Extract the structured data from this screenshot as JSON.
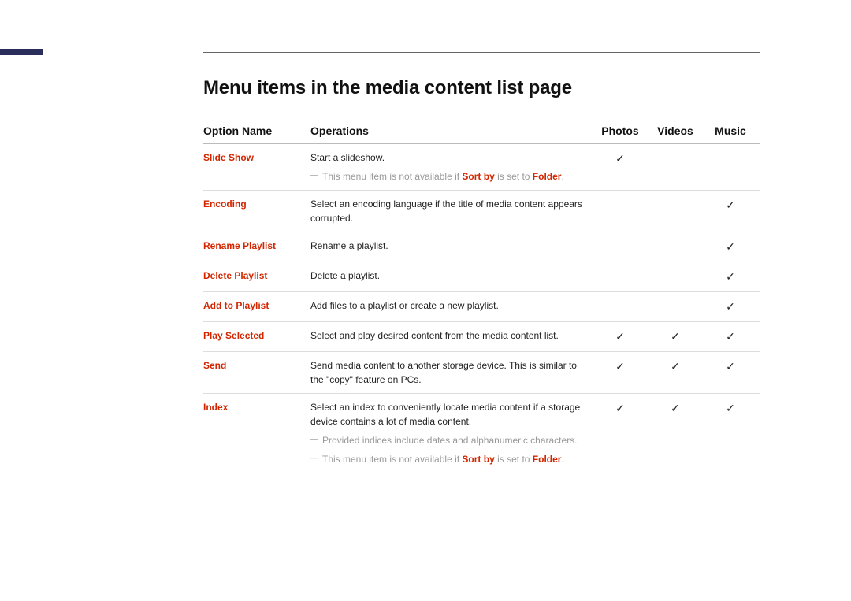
{
  "page": {
    "title": "Menu items in the media content list page"
  },
  "table": {
    "headers": {
      "option": "Option Name",
      "ops": "Operations",
      "photos": "Photos",
      "videos": "Videos",
      "music": "Music"
    },
    "note_sortby_prefix": "This menu item is not available if ",
    "note_sortby_mid": "Sort by",
    "note_sortby_mid2": " is set to ",
    "note_sortby_end": "Folder",
    "rows": {
      "slide_show": {
        "name": "Slide Show",
        "desc": "Start a slideshow.",
        "photos": "✓",
        "videos": "",
        "music": ""
      },
      "encoding": {
        "name": "Encoding",
        "desc": "Select an encoding language if the title of media content appears corrupted.",
        "photos": "",
        "videos": "",
        "music": "✓"
      },
      "rename_playlist": {
        "name": "Rename Playlist",
        "desc": "Rename a playlist.",
        "photos": "",
        "videos": "",
        "music": "✓"
      },
      "delete_playlist": {
        "name": "Delete Playlist",
        "desc": "Delete a playlist.",
        "photos": "",
        "videos": "",
        "music": "✓"
      },
      "add_playlist": {
        "name": "Add to Playlist",
        "desc": "Add files to a playlist or create a new playlist.",
        "photos": "",
        "videos": "",
        "music": "✓"
      },
      "play_selected": {
        "name": "Play Selected",
        "desc": "Select and play desired content from the media content list.",
        "photos": "✓",
        "videos": "✓",
        "music": "✓"
      },
      "send": {
        "name": "Send",
        "desc": "Send media content to another storage device. This is similar to the \"copy\" feature on PCs.",
        "photos": "✓",
        "videos": "✓",
        "music": "✓"
      },
      "index": {
        "name": "Index",
        "desc": "Select an index to conveniently locate media content if a storage device contains a lot of media content.",
        "note1": "Provided indices include dates and alphanumeric characters.",
        "photos": "✓",
        "videos": "✓",
        "music": "✓"
      }
    }
  }
}
